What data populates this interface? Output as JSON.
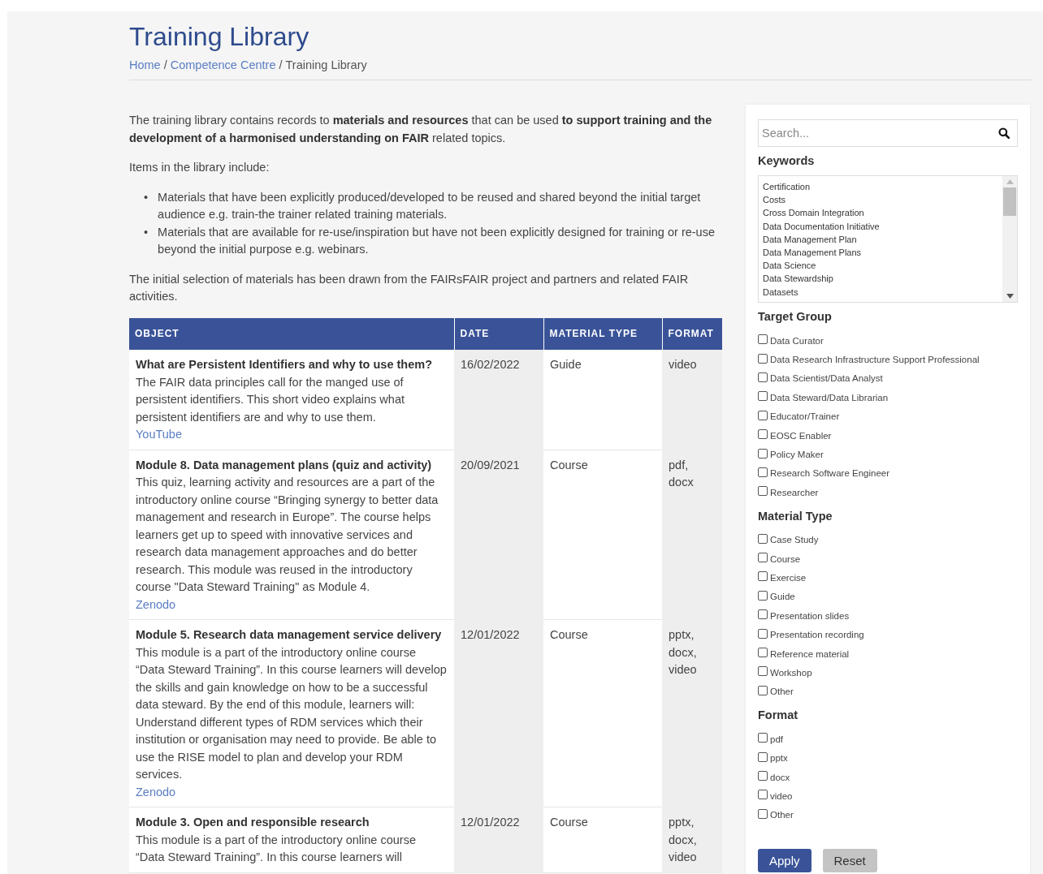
{
  "header": {
    "title": "Training Library",
    "breadcrumb": [
      {
        "label": "Home",
        "link": true
      },
      {
        "label": "/",
        "link": false
      },
      {
        "label": "Competence Centre",
        "link": true
      },
      {
        "label": "/",
        "link": false
      },
      {
        "label": "Training Library",
        "link": false
      }
    ]
  },
  "intro": {
    "paragraphs_before": [
      "The training library contains records to **materials and resources** that can be used **to support training and the development of a harmonised understanding on FAIR** related topics.",
      "Items in the library include:"
    ],
    "bullet_marker": "•",
    "bullets": [
      "Materials that have been explicitly produced/developed to be reused and shared beyond the initial target audience e.g. train-the trainer related training materials.",
      "Materials that are available for re-use/inspiration but have not been explicitly designed for training or re-use beyond the initial purpose e.g. webinars."
    ],
    "paragraphs_after": [
      "The initial selection of materials has been drawn from the FAIRsFAIR project and partners and related FAIR activities."
    ]
  },
  "table": {
    "columns": [
      "OBJECT",
      "DATE",
      "MATERIAL TYPE",
      "FORMAT"
    ],
    "rows": [
      {
        "title": "What are Persistent Identifiers and why to use them?",
        "description": "The FAIR data principles call for the manged use of persistent identifiers. This short video explains what persistent identifiers are and why to use them.",
        "source": "YouTube",
        "date": "16/02/2022",
        "material_type": "Guide",
        "format": "video"
      },
      {
        "title": "Module 8. Data management plans (quiz and activity)",
        "description": "This quiz, learning activity and resources are a part of the introductory online course “Bringing synergy to better data management and research in Europe”. The course helps learners get up to speed with innovative services and research data management approaches and do better research. This module was reused in the introductory course \"Data Steward Training\" as Module 4.",
        "source": "Zenodo",
        "date": "20/09/2021",
        "material_type": "Course",
        "format": "pdf, docx"
      },
      {
        "title": "Module 5. Research data management service delivery",
        "description": "This module is a part of the introductory online course “Data Steward Training”. In this course learners will develop the skills and gain knowledge on how to be a successful data steward. By the end of this module, learners will: Understand different types of RDM services which their institution or organisation may need to provide. Be able to use the RISE model to plan and develop your RDM services.",
        "source": "Zenodo",
        "date": "12/01/2022",
        "material_type": "Course",
        "format": "pptx, docx, video"
      },
      {
        "title": "Module 3. Open and responsible research",
        "description": "This module is a part of the introductory online course “Data Steward Training”. In this course learners will",
        "date": "12/01/2022",
        "material_type": "Course",
        "format": "pptx, docx, video"
      }
    ]
  },
  "sidebar": {
    "search": {
      "placeholder": "Search..."
    },
    "keywords": {
      "heading": "Keywords",
      "items": [
        "Certification",
        "Costs",
        "Cross Domain Integration",
        "Data Documentation Initiative",
        "Data Management Plan",
        "Data Management Plans",
        "Data Science",
        "Data Stewardship",
        "Datasets"
      ]
    },
    "filters": [
      {
        "heading": "Target Group",
        "items": [
          {
            "label": "Data Curator",
            "checked": false
          },
          {
            "label": "Data Research Infrastructure Support Professional",
            "checked": false
          },
          {
            "label": "Data Scientist/Data Analyst",
            "checked": false
          },
          {
            "label": "Data Steward/Data Librarian",
            "checked": false
          },
          {
            "label": "Educator/Trainer",
            "checked": false
          },
          {
            "label": "EOSC Enabler",
            "checked": false
          },
          {
            "label": "Policy Maker",
            "checked": false
          },
          {
            "label": "Research Software Engineer",
            "checked": false
          },
          {
            "label": "Researcher",
            "checked": false
          }
        ]
      },
      {
        "heading": "Material Type",
        "items": [
          {
            "label": "Case Study",
            "checked": false
          },
          {
            "label": "Course",
            "checked": false
          },
          {
            "label": "Exercise",
            "checked": false
          },
          {
            "label": "Guide",
            "checked": false
          },
          {
            "label": "Presentation slides",
            "checked": false
          },
          {
            "label": "Presentation recording",
            "checked": false
          },
          {
            "label": "Reference material",
            "checked": false
          },
          {
            "label": "Workshop",
            "checked": false
          },
          {
            "label": "Other",
            "checked": false
          }
        ]
      },
      {
        "heading": "Format",
        "items": [
          {
            "label": "pdf",
            "checked": false
          },
          {
            "label": "pptx",
            "checked": false
          },
          {
            "label": "docx",
            "checked": false
          },
          {
            "label": "video",
            "checked": false
          },
          {
            "label": "Other",
            "checked": false
          }
        ]
      }
    ],
    "buttons": [
      {
        "label": "Apply",
        "kind": "primary"
      },
      {
        "label": "Reset",
        "kind": "secondary"
      }
    ]
  }
}
